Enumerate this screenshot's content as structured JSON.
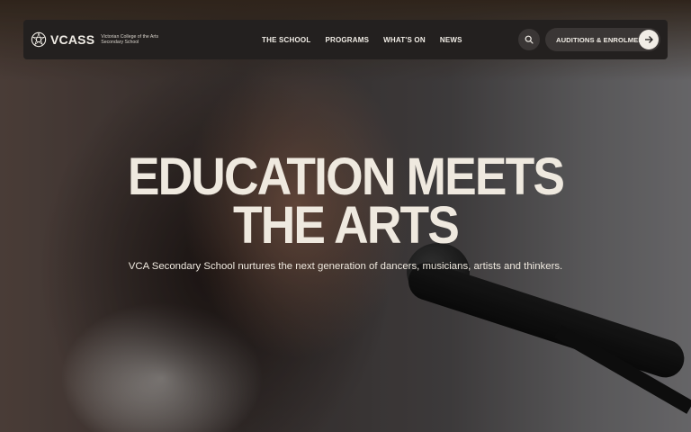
{
  "brand": {
    "wordmark": "VCASS",
    "tagline": "Victorian College of the Arts Secondary School",
    "logo_icon": "rose-seal-icon"
  },
  "nav": {
    "items": [
      {
        "label": "THE SCHOOL"
      },
      {
        "label": "PROGRAMS"
      },
      {
        "label": "WHAT'S ON"
      },
      {
        "label": "NEWS"
      }
    ],
    "search_icon": "search-icon",
    "cta_label": "AUDITIONS & ENROLMENT",
    "cta_icon": "arrow-right-icon"
  },
  "hero": {
    "headline_line1": "EDUCATION MEETS",
    "headline_line2": "THE ARTS",
    "subheading": "VCA Secondary School nurtures the next generation of dancers, musicians, artists and thinkers."
  },
  "colors": {
    "nav_bg": "#23201f",
    "text_light": "#efe9df",
    "button_bg": "#3a3635"
  }
}
